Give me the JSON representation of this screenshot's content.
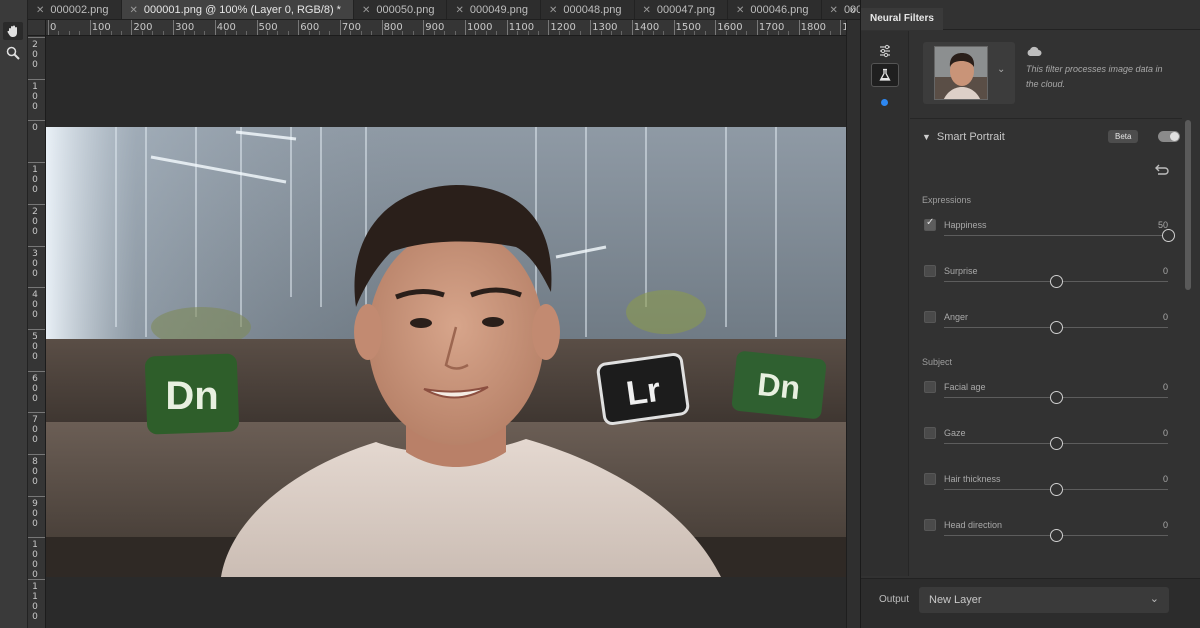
{
  "tabs": [
    {
      "label": "000002.png",
      "active": false
    },
    {
      "label": "000001.png @ 100% (Layer 0, RGB/8) *",
      "active": true
    },
    {
      "label": "000050.png",
      "active": false
    },
    {
      "label": "000049.png",
      "active": false
    },
    {
      "label": "000048.png",
      "active": false
    },
    {
      "label": "000047.png",
      "active": false
    },
    {
      "label": "000046.png",
      "active": false
    },
    {
      "label": "000045.pn",
      "active": false
    }
  ],
  "tabs_more": "»",
  "ruler": {
    "h_labels": [
      "0",
      "100",
      "200",
      "300",
      "400",
      "500",
      "600",
      "700",
      "800",
      "900",
      "1000",
      "1100",
      "1200",
      "1300",
      "1400",
      "1500",
      "1600",
      "1700",
      "1800",
      "19"
    ],
    "v_labels": [
      "200",
      "100",
      "0",
      "100",
      "200",
      "300",
      "400",
      "500",
      "600",
      "700",
      "800",
      "900",
      "1000",
      "1100"
    ]
  },
  "photo": {
    "pillows": [
      "Dn",
      "Lr",
      "Dn"
    ]
  },
  "panel": {
    "title": "Neural Filters",
    "cloud_text": "This filter processes image data in the cloud.",
    "filter_name": "Smart Portrait",
    "beta_label": "Beta",
    "sections": {
      "expressions": "Expressions",
      "subject": "Subject"
    },
    "expressions": [
      {
        "label": "Happiness",
        "value": "50",
        "checked": true,
        "level": 1.0
      },
      {
        "label": "Surprise",
        "value": "0",
        "checked": false,
        "level": 0.5
      },
      {
        "label": "Anger",
        "value": "0",
        "checked": false,
        "level": 0.5
      }
    ],
    "subject": [
      {
        "label": "Facial age",
        "value": "0",
        "checked": false,
        "level": 0.5
      },
      {
        "label": "Gaze",
        "value": "0",
        "checked": false,
        "level": 0.5
      },
      {
        "label": "Hair thickness",
        "value": "0",
        "checked": false,
        "level": 0.5
      },
      {
        "label": "Head direction",
        "value": "0",
        "checked": false,
        "level": 0.5
      }
    ],
    "output_label": "Output",
    "output_value": "New Layer"
  },
  "colors": {
    "accent_dot": "#2d87f0",
    "panel_bg": "#323232",
    "canvas_bg": "#2a2a2a"
  }
}
